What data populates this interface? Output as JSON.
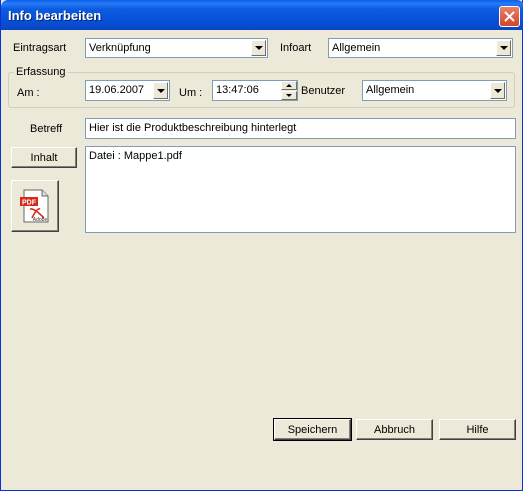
{
  "window": {
    "title": "Info bearbeiten"
  },
  "entry_type": {
    "label": "Eintragsart",
    "value": "Verknüpfung"
  },
  "info_type": {
    "label": "Infoart",
    "value": "Allgemein"
  },
  "capture_group": {
    "legend": "Erfassung",
    "date_label": "Am :",
    "date_value": "19.06.2007",
    "time_label": "Um :",
    "time_value": "13:47:06",
    "user_label": "Benutzer",
    "user_value": "Allgemein"
  },
  "subject": {
    "label": "Betreff",
    "value": "Hier ist die Produktbeschreibung hinterlegt"
  },
  "content": {
    "button_label": "Inhalt",
    "text": "Datei : Mappe1.pdf"
  },
  "pdf_icon": {
    "badge": "PDF",
    "brand": "Adobe"
  },
  "footer": {
    "save": "Speichern",
    "cancel": "Abbruch",
    "help": "Hilfe"
  }
}
